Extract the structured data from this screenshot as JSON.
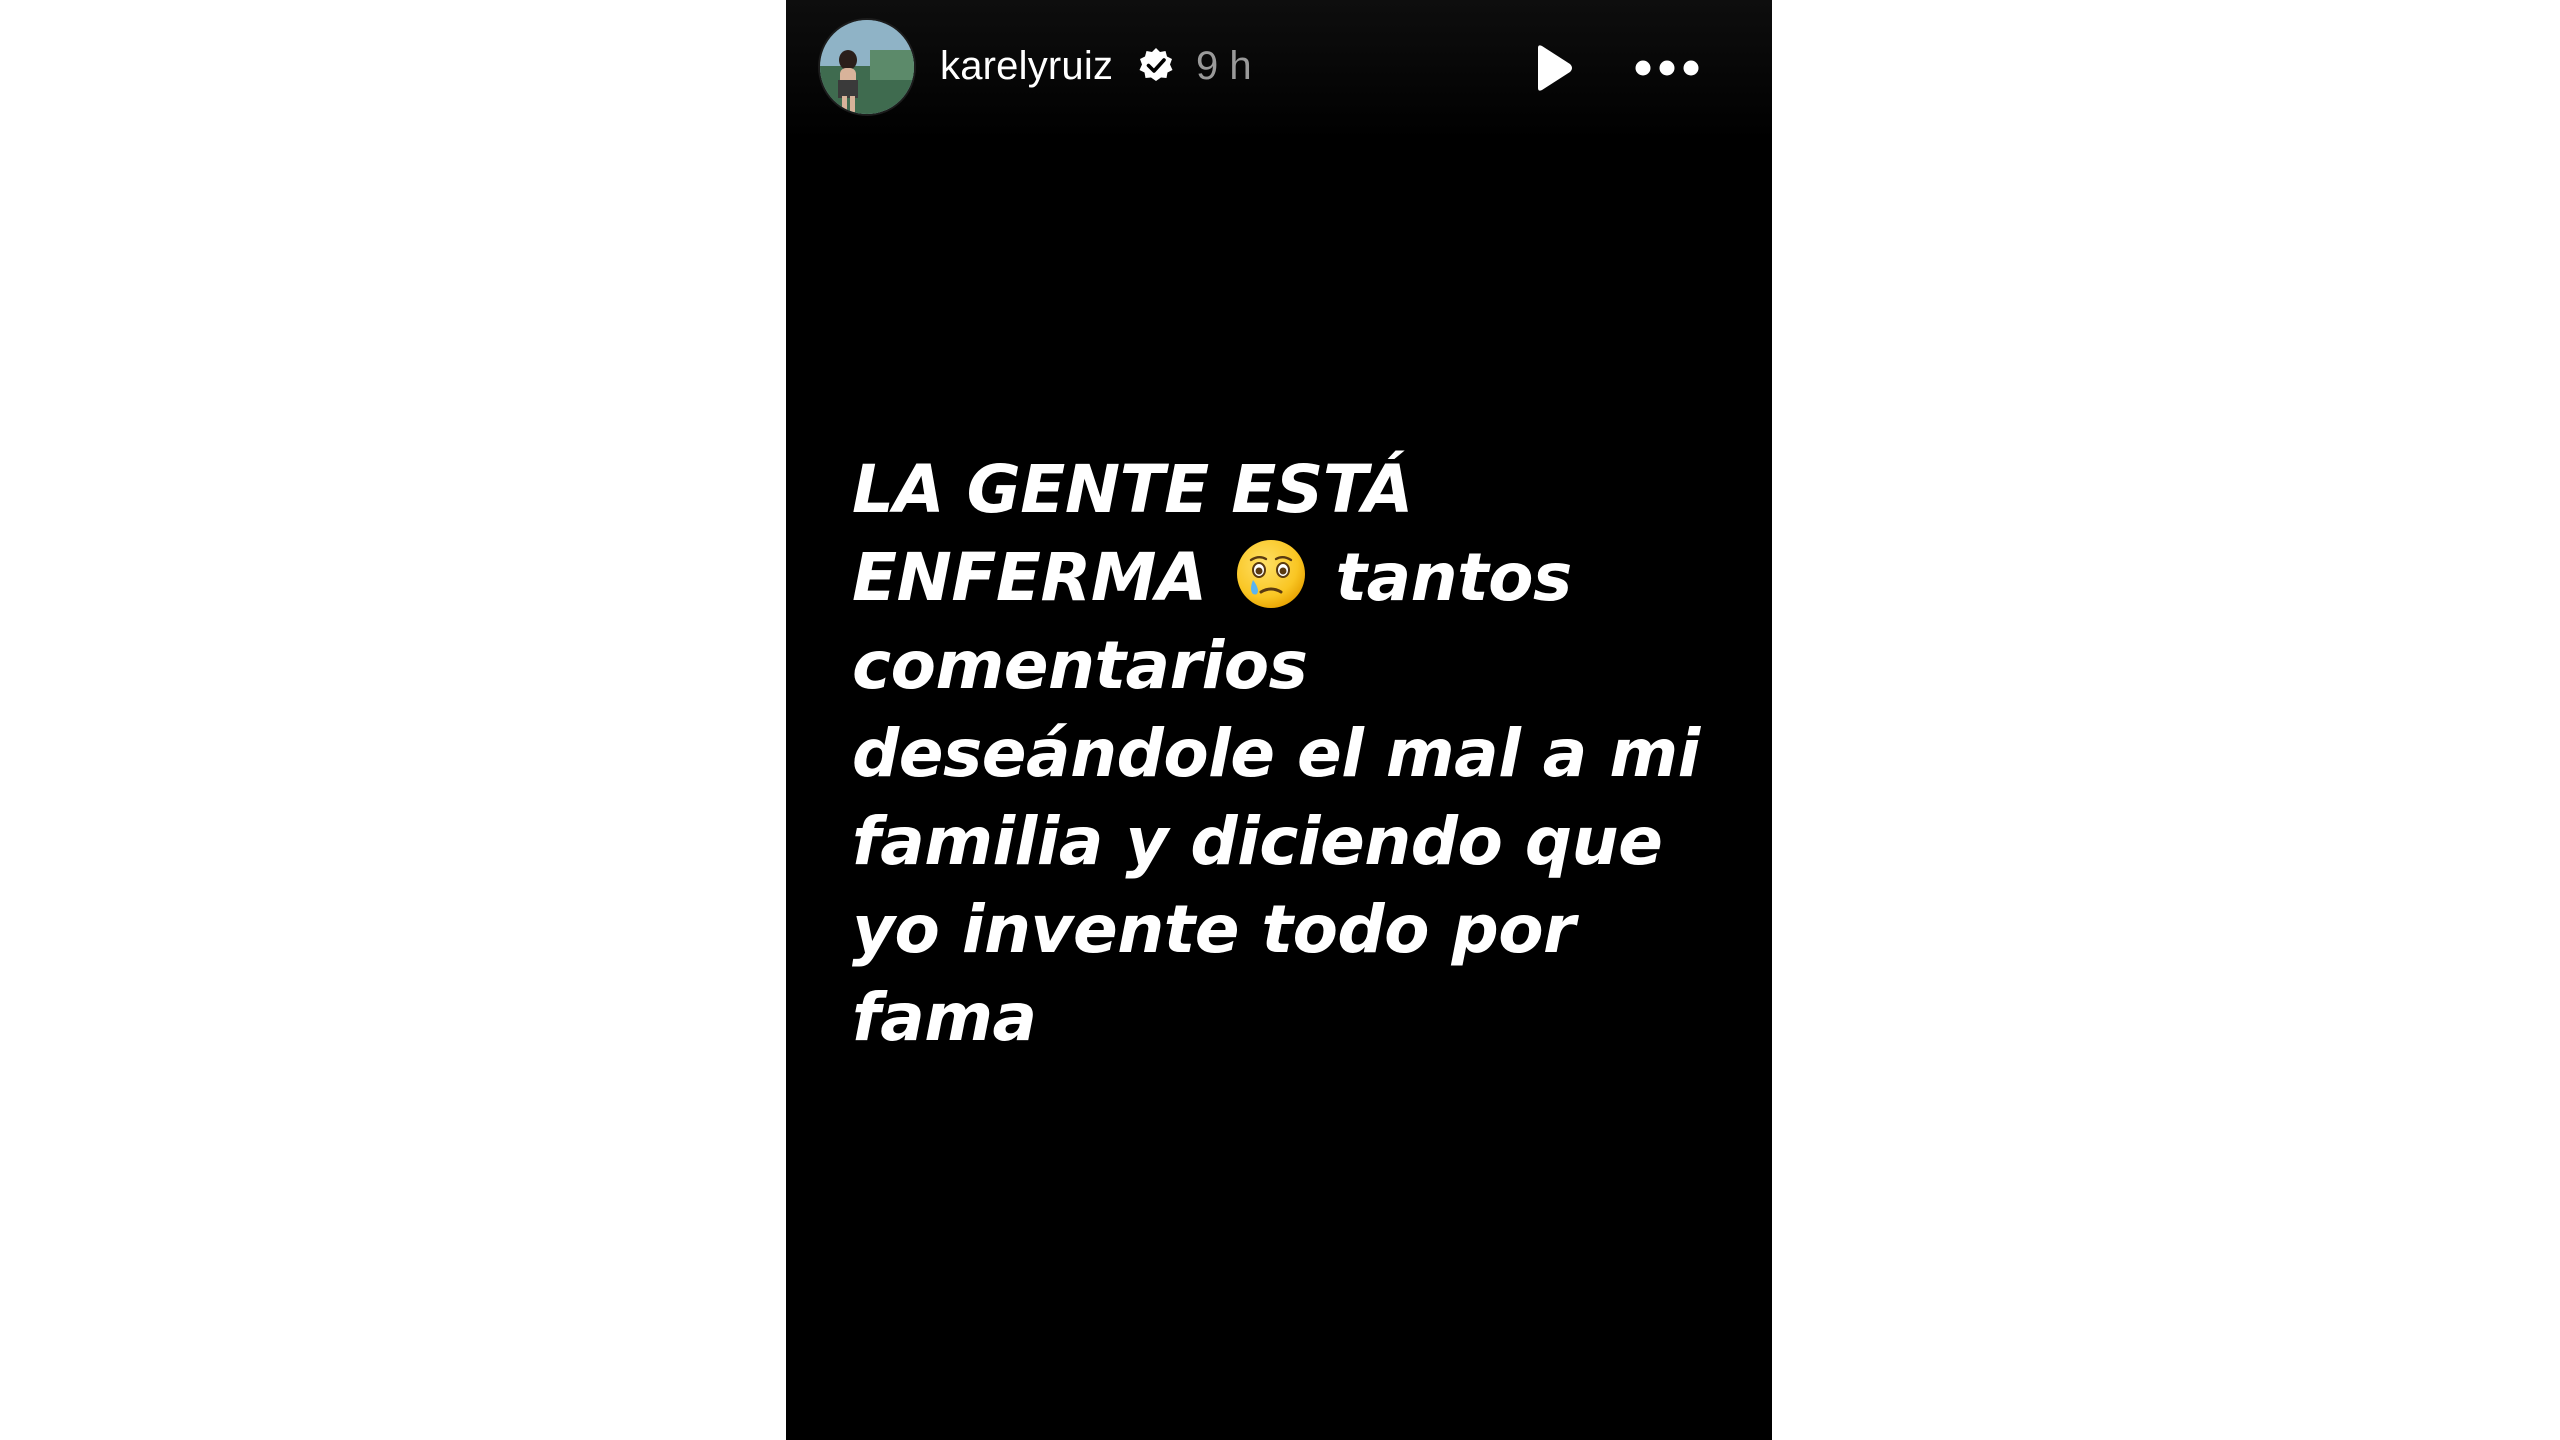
{
  "story": {
    "username": "karelyruiz",
    "timestamp": "9 h",
    "verified": true,
    "text_part1": "LA GENTE ESTÁ ENFERMA",
    "emoji": "face-holding-back-tears-emoji",
    "text_part2": "tantos comentarios deseándole el mal a mi familia y diciendo que yo invente todo por fama"
  },
  "controls": {
    "play_icon": "play-icon",
    "more_icon": "more-horizontal-icon"
  },
  "colors": {
    "story_background": "#000000",
    "page_background": "#ffffff",
    "text": "#ffffff",
    "timestamp": "#9a9a9a"
  }
}
